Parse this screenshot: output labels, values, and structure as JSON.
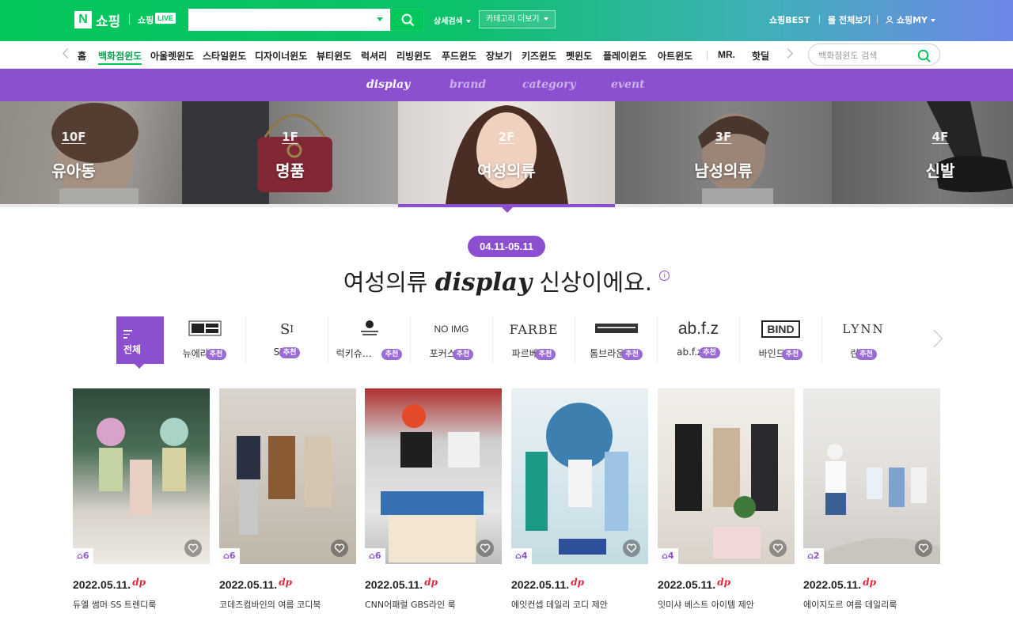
{
  "top": {
    "logo_mark": "N",
    "logo_text": "쇼핑",
    "live_text": "쇼핑",
    "live_badge": "LIVE",
    "search_value": "",
    "detail_search": "상세검색",
    "category_more": "카테고리 더보기",
    "links": [
      "쇼핑BEST",
      "몰 전체보기",
      "쇼핑MY"
    ]
  },
  "nav": {
    "items": [
      "홈",
      "백화점윈도",
      "아울렛윈도",
      "스타일윈도",
      "디자이너윈도",
      "뷰티윈도",
      "럭셔리",
      "리빙윈도",
      "푸드윈도",
      "장보기",
      "키즈윈도",
      "펫윈도",
      "플레이윈도",
      "아트윈도",
      "MR.",
      "핫딜"
    ],
    "active": "백화점윈도",
    "search_placeholder": "백화점윈도 검색"
  },
  "tabs": [
    "display",
    "brand",
    "category",
    "event"
  ],
  "active_tab": "display",
  "floors": [
    {
      "floor": "10F",
      "name": "유아동"
    },
    {
      "floor": "1F",
      "name": "명품"
    },
    {
      "floor": "2F",
      "name": "여성의류"
    },
    {
      "floor": "3F",
      "name": "남성의류"
    },
    {
      "floor": "4F",
      "name": "신발"
    }
  ],
  "active_floor": "여성의류",
  "period": "04.11-05.11",
  "headline": {
    "pre": "여성의류",
    "em": "display",
    "post": "신상이에요."
  },
  "info_icon": "i",
  "filter_all": "전체",
  "recommend_badge": "추천",
  "brands": [
    {
      "logo": "NEW ERA",
      "name": "뉴에라"
    },
    {
      "logo": "SI",
      "name": "SI"
    },
    {
      "logo": "LUCKY CHOUETTE",
      "name": "럭키슈…"
    },
    {
      "logo": "NO IMG",
      "name": "포커스"
    },
    {
      "logo": "FARBE",
      "name": "파르베"
    },
    {
      "logo": "THOM BROWNE",
      "name": "톰브라운"
    },
    {
      "logo": "ab.f.z",
      "name": "ab.f.z"
    },
    {
      "logo": "BIND",
      "name": "바인드"
    },
    {
      "logo": "LYNN",
      "name": "린"
    }
  ],
  "cards": [
    {
      "count": "6",
      "date": "2022.05.11.",
      "mark": "dp",
      "title": "듀엘 썸머 SS 트렌디룩"
    },
    {
      "count": "6",
      "date": "2022.05.11.",
      "mark": "dp",
      "title": "코데즈컴바인의 여름 코디북"
    },
    {
      "count": "6",
      "date": "2022.05.11.",
      "mark": "dp",
      "title": "CNN어패럴 GBS라인 룩"
    },
    {
      "count": "4",
      "date": "2022.05.11.",
      "mark": "dp",
      "title": "에잇컨셉 데일리 코디 제안"
    },
    {
      "count": "4",
      "date": "2022.05.11.",
      "mark": "dp",
      "title": "잇미샤 베스트 아이템 제안"
    },
    {
      "count": "2",
      "date": "2022.05.11.",
      "mark": "dp",
      "title": "에이지도르 여름 데일리룩"
    }
  ],
  "colors": {
    "brand_green": "#03c75a",
    "purple": "#8c4fcf",
    "dp_red": "#e0263d"
  }
}
